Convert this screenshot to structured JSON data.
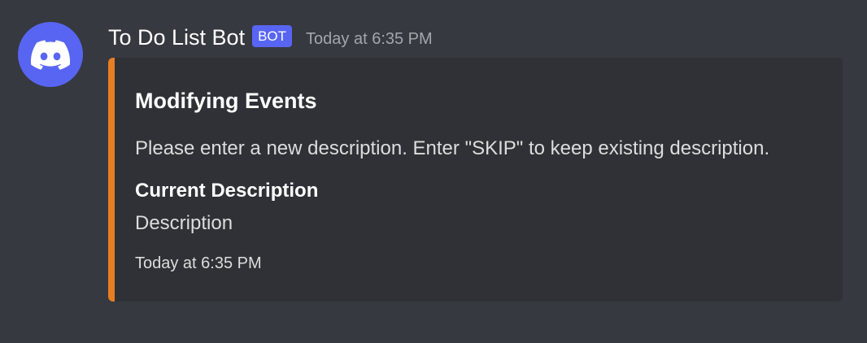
{
  "message": {
    "author": {
      "name": "To Do List Bot",
      "tag": "BOT",
      "avatar_icon": "discord-logo-icon"
    },
    "timestamp": "Today at 6:35 PM"
  },
  "embed": {
    "accent_color": "#e67e22",
    "title": "Modifying Events",
    "description": "Please enter a new description. Enter \"SKIP\" to keep existing description.",
    "fields": [
      {
        "name": "Current Description",
        "value": "Description"
      }
    ],
    "footer": "Today at 6:35 PM"
  },
  "colors": {
    "background": "#36393f",
    "embed_background": "#2f3136",
    "brand": "#5865f2"
  }
}
